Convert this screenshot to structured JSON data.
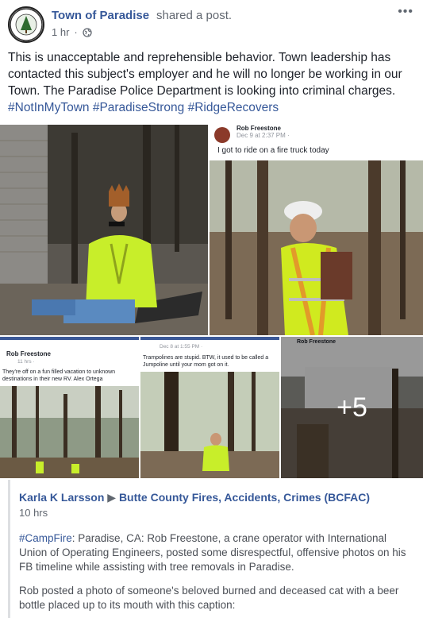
{
  "post": {
    "page_name": "Town of Paradise",
    "shared_text": "shared a post.",
    "time": "1 hr",
    "privacy_sep": "·",
    "more": "•••",
    "body": "This is unacceptable and reprehensible behavior. Town leadership has contacted this subject's employer and he will no longer be working in our Town. The Paradise Police Department is looking into criminal charges.",
    "hashtags": "#NotInMyTown #ParadiseStrong #RidgeRecovers"
  },
  "photos": {
    "p2": {
      "name": "Rob Freestone",
      "meta": "Dec 9 at 2:37 PM ·",
      "caption": "I got to ride on a fire truck today"
    },
    "p3": {
      "name": "Rob Freestone",
      "meta": "11 hrs ·",
      "caption": "They're off on a fun filled vacation to unknown destinations in their new RV. Alex Ortega"
    },
    "p4": {
      "meta": "Dec 8 at 1:55 PM ·",
      "caption": "Trampolines are stupid. BTW, it used to be called a Jumpoline until your mom got on it."
    },
    "p5": {
      "name": "Rob Freestone",
      "more_count": "+5"
    }
  },
  "shared_post": {
    "author": "Karla K Larsson",
    "arrow": "▶",
    "group": "Butte County Fires, Accidents, Crimes (BCFAC)",
    "time": "10 hrs",
    "tag": "#CampFire",
    "p1_rest": ": Paradise, CA: Rob Freestone, a crane operator with International Union of Operating Engineers, posted some disrespectful, offensive photos on his FB timeline while assisting with tree removals in Paradise.",
    "p2": "Rob posted a photo of someone's beloved burned and deceased cat with a beer bottle placed up to its mouth with this caption:"
  }
}
